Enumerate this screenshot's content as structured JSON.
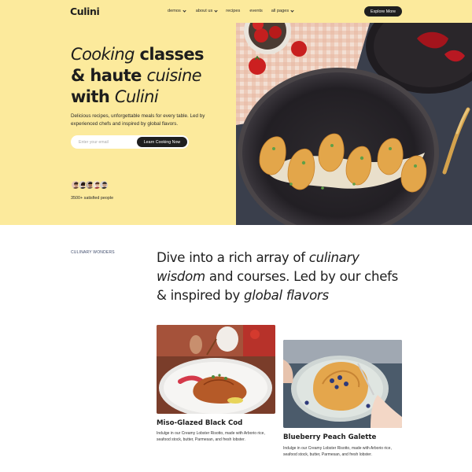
{
  "brand": {
    "logo": "Culini"
  },
  "nav": {
    "items": [
      {
        "label": "demos",
        "has_dropdown": true
      },
      {
        "label": "about us",
        "has_dropdown": true
      },
      {
        "label": "recipes",
        "has_dropdown": false
      },
      {
        "label": "events",
        "has_dropdown": false
      },
      {
        "label": "all pages",
        "has_dropdown": true
      }
    ],
    "cta_label": "Explore More"
  },
  "hero": {
    "headline": {
      "l1_italic": "Cooking",
      "l1_rest": " classes",
      "l2_start": "& haute ",
      "l2_italic": "cuisine",
      "l3_start": "with ",
      "l3_italic": "Culini"
    },
    "description": "Delicious recipes, unforgettable meals for every table. Led by experienced chefs and inspired by global flavors.",
    "email_placeholder": "Enter your email",
    "cta_label": "Learn Cooking Now",
    "social_proof": "3500+ satisfied people"
  },
  "section2": {
    "eyebrow": "CULINARY WONDERS",
    "heading": {
      "p1": "Dive into a rich array of ",
      "p1_italic": "culinary wisdom",
      "p2": " and courses. Led by our chefs & inspired by ",
      "p2_italic": "global flavors"
    },
    "cards": [
      {
        "title": "Miso-Glazed Black Cod",
        "description": "Indulge in our Creamy Lobster Risotto, made with Arborio rice, seafood stock, butter, Parmesan, and fresh lobster."
      },
      {
        "title": "Blueberry Peach Galette",
        "description": "Indulge in our Creamy Lobster Risotto, made with Arborio rice, seafood stock, butter, Parmesan, and fresh lobster."
      }
    ]
  },
  "colors": {
    "accent_yellow": "#fcea9c",
    "dark": "#1f1f1f",
    "eyebrow_blue": "#3d4a6a"
  }
}
